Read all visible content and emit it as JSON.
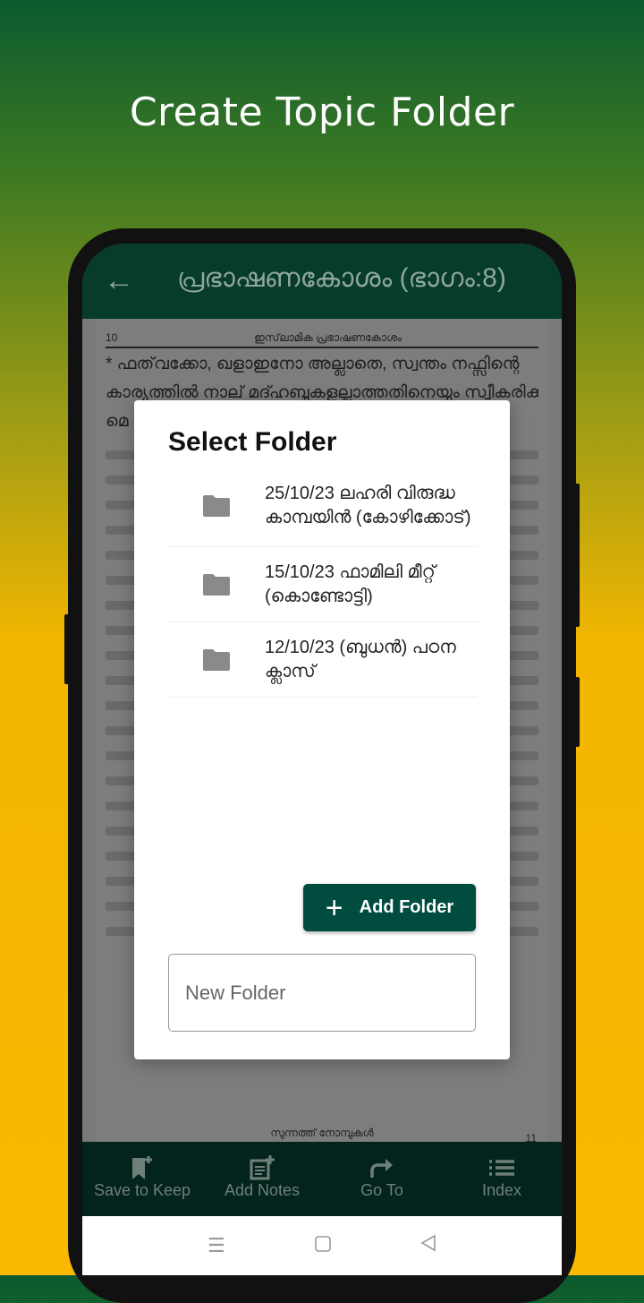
{
  "promo_title": "Create Topic Folder",
  "appbar": {
    "title": "പ്രഭാഷണകോശം (ഭാഗം:8)"
  },
  "page": {
    "number": "10",
    "header": "ഇസ്‌ലാമിക പ്രഭാഷണകോശം",
    "lines": [
      "* ഫത്‌വക്കോ, ഖളാഇനോ അല്ലാതെ, സ്വന്തം നഫ്സിന്റെ",
      "കാര്യത്തിൽ നാല് മദ്ഹബുകളല്ലാത്തതിനെയും സ്വീകരിക്കാ",
      "മെ"
    ],
    "next_header": "സുന്നത്ത് നോമ്പുകൾ",
    "next_number": "11"
  },
  "dialog": {
    "title": "Select Folder",
    "folders": [
      {
        "label": "25/10/23 ലഹരി വിരുദ്ധ കാമ്പയിൻ (കോഴിക്കോട്)",
        "icon": "folder-icon"
      },
      {
        "label": "15/10/23 ഫാമിലി മീറ്റ് (കൊണ്ടോട്ടി)",
        "icon": "folder-icon"
      },
      {
        "label": "12/10/23 (ബുധൻ) പഠന ക്ലാസ്",
        "icon": "folder-icon"
      }
    ],
    "add_button": "Add Folder",
    "input_placeholder": "New Folder",
    "input_value": ""
  },
  "bottom_nav": [
    {
      "label": "Save to Keep",
      "icon": "bookmark-add-icon"
    },
    {
      "label": "Add Notes",
      "icon": "note-add-icon"
    },
    {
      "label": "Go To",
      "icon": "forward-arrow-icon"
    },
    {
      "label": "Index",
      "icon": "list-icon"
    }
  ],
  "colors": {
    "appbar": "#073b2c",
    "button": "#004d40",
    "bottom_nav": "#02241c"
  }
}
